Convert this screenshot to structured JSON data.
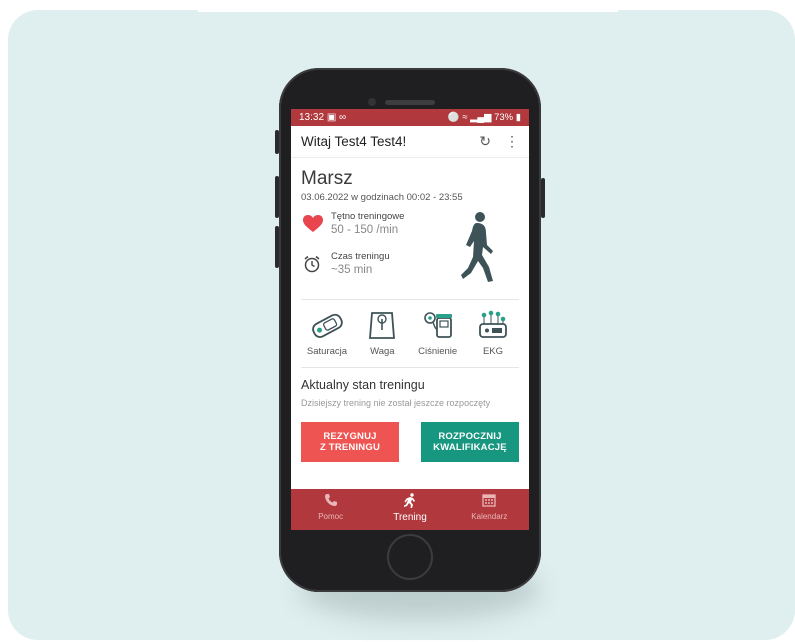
{
  "status_bar": {
    "time": "13:32",
    "battery": "73%"
  },
  "app_bar": {
    "title": "Witaj Test4 Test4!"
  },
  "training": {
    "activity": "Marsz",
    "date": "03.06.2022 w godzinach 00:02 - 23:55",
    "heart_rate_label": "Tętno treningowe",
    "heart_rate_value": "50 - 150 /min",
    "time_label": "Czas treningu",
    "time_value": "~35 min"
  },
  "devices": [
    {
      "label": "Saturacja",
      "icon": "pulse-oximeter-icon"
    },
    {
      "label": "Waga",
      "icon": "scale-icon"
    },
    {
      "label": "Ciśnienie",
      "icon": "blood-pressure-icon"
    },
    {
      "label": "EKG",
      "icon": "ecg-device-icon"
    }
  ],
  "status_section": {
    "title": "Aktualny stan treningu",
    "subtitle": "Dzisiejszy trening nie został jeszcze rozpoczęty"
  },
  "buttons": {
    "resign_line1": "REZYGNUJ",
    "resign_line2": "Z TRENINGU",
    "start_line1": "ROZPOCZNIJ",
    "start_line2": "KWALIFIKACJĘ"
  },
  "nav": [
    {
      "label": "Pomoc",
      "icon": "phone-icon"
    },
    {
      "label": "Trening",
      "icon": "running-icon",
      "active": true
    },
    {
      "label": "Kalendarz",
      "icon": "calendar-icon"
    }
  ],
  "colors": {
    "brand_red": "#b1393d",
    "button_red": "#ee5452",
    "button_green": "#179780",
    "heart": "#e8454f",
    "icon_dark": "#3e5358",
    "icon_teal": "#2aa089",
    "backdrop": "#dfeeee"
  }
}
